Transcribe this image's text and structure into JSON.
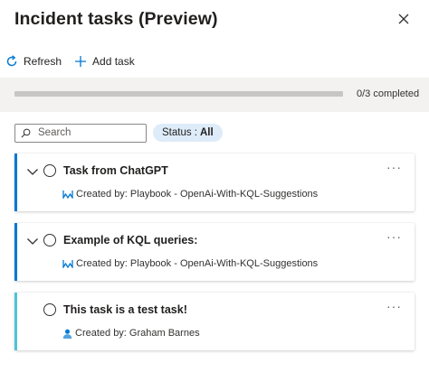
{
  "panel": {
    "title": "Incident tasks (Preview)"
  },
  "toolbar": {
    "refresh_label": "Refresh",
    "add_task_label": "Add task"
  },
  "progress": {
    "completed": 0,
    "total": 3,
    "label": "0/3 completed",
    "fill_fraction": 0
  },
  "filters": {
    "search_placeholder": "Search",
    "status_prefix": "Status :",
    "status_value": "All"
  },
  "colors": {
    "accent": "#0078d4",
    "playbook_task_bar": "#0078d4",
    "user_task_bar": "#4fc3d9",
    "status_pill_bg": "#deecf9"
  },
  "tasks": [
    {
      "title": "Task from ChatGPT",
      "created_by": "Created by: Playbook - OpenAi-With-KQL-Suggestions",
      "creator_icon": "playbook-icon",
      "expandable": true,
      "more_label": "···"
    },
    {
      "title": "Example of KQL queries:",
      "created_by": "Created by: Playbook - OpenAi-With-KQL-Suggestions",
      "creator_icon": "playbook-icon",
      "expandable": true,
      "more_label": "···"
    },
    {
      "title": "This task is a test task!",
      "created_by": "Created by: Graham Barnes",
      "creator_icon": "user-icon",
      "expandable": false,
      "more_label": "···"
    }
  ]
}
